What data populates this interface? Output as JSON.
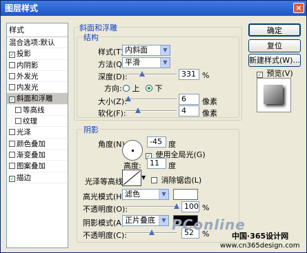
{
  "window": {
    "title": "图层样式",
    "close_glyph": "×"
  },
  "styles_list": {
    "header": "样式",
    "items": [
      {
        "label": "混合选项:默认",
        "checkbox": false,
        "checked": false,
        "sub": false,
        "selected": false
      },
      {
        "label": "投影",
        "checkbox": true,
        "checked": true,
        "sub": false,
        "selected": false
      },
      {
        "label": "内阴影",
        "checkbox": true,
        "checked": false,
        "sub": false,
        "selected": false
      },
      {
        "label": "外发光",
        "checkbox": true,
        "checked": false,
        "sub": false,
        "selected": false
      },
      {
        "label": "内发光",
        "checkbox": true,
        "checked": false,
        "sub": false,
        "selected": false
      },
      {
        "label": "斜面和浮雕",
        "checkbox": true,
        "checked": true,
        "sub": false,
        "selected": true
      },
      {
        "label": "等高线",
        "checkbox": true,
        "checked": false,
        "sub": true,
        "selected": false
      },
      {
        "label": "纹理",
        "checkbox": true,
        "checked": false,
        "sub": true,
        "selected": false
      },
      {
        "label": "光泽",
        "checkbox": true,
        "checked": false,
        "sub": false,
        "selected": false
      },
      {
        "label": "颜色叠加",
        "checkbox": true,
        "checked": false,
        "sub": false,
        "selected": false
      },
      {
        "label": "渐变叠加",
        "checkbox": true,
        "checked": false,
        "sub": false,
        "selected": false
      },
      {
        "label": "图案叠加",
        "checkbox": true,
        "checked": false,
        "sub": false,
        "selected": false
      },
      {
        "label": "描边",
        "checkbox": true,
        "checked": true,
        "sub": false,
        "selected": false
      }
    ]
  },
  "bevel": {
    "section_title": "斜面和浮雕",
    "structure_title": "结构",
    "style_label": "样式(T):",
    "style_value": "内斜面",
    "technique_label": "方法(Q):",
    "technique_value": "平滑",
    "depth_label": "深度(D):",
    "depth_value": "331",
    "depth_unit": "%",
    "depth_level": 0.33,
    "direction_label": "方向:",
    "dir_up": "上",
    "dir_down": "下",
    "size_label": "大小(Z):",
    "size_value": "6",
    "size_unit": "像素",
    "size_level": 0.07,
    "soften_label": "软化(F):",
    "soften_value": "4",
    "soften_unit": "像素",
    "soften_level": 0.25
  },
  "shading": {
    "title": "阴影",
    "angle_label": "角度(N):",
    "angle_value": "-45",
    "angle_unit": "度",
    "global_light": "使用全局光(G)",
    "altitude_label": "高度:",
    "altitude_value": "11",
    "altitude_unit": "度",
    "gloss_label": "光泽等高线:",
    "antialias": "消除锯齿(L)",
    "highlight_label": "高光模式(H):",
    "highlight_mode": "滤色",
    "highlight_color": "#ffffff",
    "hl_opacity_label": "不透明度(O):",
    "hl_opacity_value": "100",
    "hl_opacity_unit": "%",
    "hl_opacity_level": 1.0,
    "shadow_label": "阴影模式(A):",
    "shadow_mode": "正片叠底",
    "shadow_color": "#000000",
    "sh_opacity_label": "不透明度(C):",
    "sh_opacity_value": "52",
    "sh_opacity_unit": "%",
    "sh_opacity_level": 0.52
  },
  "buttons": {
    "ok": "确定",
    "reset": "复位",
    "new_style": "新建样式(W)...",
    "preview": "预览(V)"
  },
  "watermark": {
    "logo": "PConline",
    "line1": "中国·365设计网",
    "line2": "www.cn365design.com"
  },
  "colors": {
    "title_bar": "#2a5fcf",
    "accent": "#1140cc",
    "check": "#21a121"
  }
}
